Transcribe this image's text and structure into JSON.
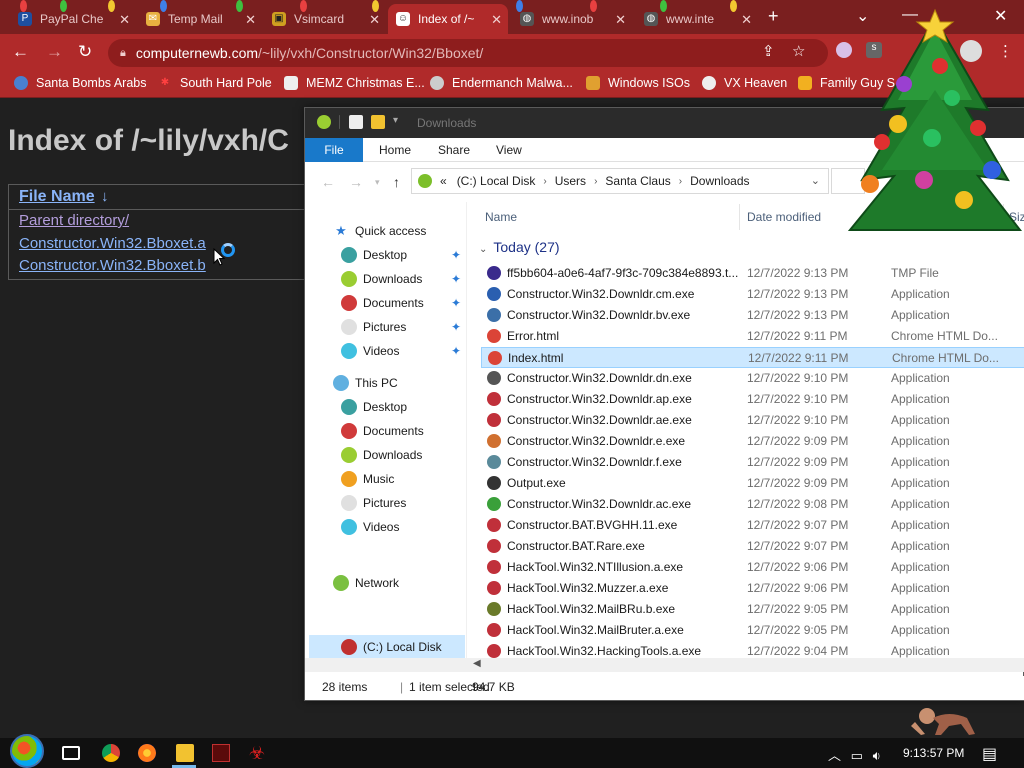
{
  "browser": {
    "tabs": [
      {
        "label": "PayPal Che",
        "active": false
      },
      {
        "label": "Temp Mail",
        "active": false
      },
      {
        "label": "Vsimcard",
        "active": false
      },
      {
        "label": "Index of /~",
        "active": true
      },
      {
        "label": "www.inob",
        "active": false
      },
      {
        "label": "www.inte",
        "active": false
      }
    ],
    "url_host": "computernewb.com",
    "url_path": "/~lily/vxh/Constructor/Win32/Bboxet/",
    "bookmarks": [
      {
        "label": "Santa Bombs Arabs"
      },
      {
        "label": "South Hard Pole"
      },
      {
        "label": "MEMZ Christmas E..."
      },
      {
        "label": "Endermanch Malwa..."
      },
      {
        "label": "Windows ISOs"
      },
      {
        "label": "VX Heaven"
      },
      {
        "label": "Family Guy S"
      }
    ]
  },
  "webpage": {
    "title": "Index of /~lily/vxh/C",
    "column_header": "File Name",
    "sort_arrow": "↓",
    "links": [
      "Parent directory/",
      "Constructor.Win32.Bboxet.a",
      "Constructor.Win32.Bboxet.b"
    ]
  },
  "explorer": {
    "title": "Downloads",
    "ribbon_tabs": [
      "File",
      "Home",
      "Share",
      "View"
    ],
    "breadcrumb": [
      "(C:) Local Disk",
      "Users",
      "Santa Claus",
      "Downloads"
    ],
    "breadcrumb_prefix": "«",
    "nav": {
      "quick_access": "Quick access",
      "quick_items": [
        "Desktop",
        "Downloads",
        "Documents",
        "Pictures",
        "Videos"
      ],
      "this_pc": "This PC",
      "pc_items": [
        "Desktop",
        "Documents",
        "Downloads",
        "Music",
        "Pictures",
        "Videos",
        "(C:) Local Disk"
      ],
      "network": "Network"
    },
    "columns": {
      "name": "Name",
      "date": "Date modified",
      "type": "Type",
      "size": "Siz"
    },
    "group_label": "Today (27)",
    "files": [
      {
        "name": "ff5bb604-a0e6-4af7-9f3c-709c384e8893.t...",
        "date": "12/7/2022 9:13 PM",
        "type": "TMP File",
        "icon": "tmp-icon",
        "color": "#3a2a8c"
      },
      {
        "name": "Constructor.Win32.Downldr.cm.exe",
        "date": "12/7/2022 9:13 PM",
        "type": "Application",
        "icon": "exe-icon",
        "color": "#2a5fb0"
      },
      {
        "name": "Constructor.Win32.Downldr.bv.exe",
        "date": "12/7/2022 9:13 PM",
        "type": "Application",
        "icon": "exe-icon",
        "color": "#3b6fa8"
      },
      {
        "name": "Error.html",
        "date": "12/7/2022 9:11 PM",
        "type": "Chrome HTML Do...",
        "icon": "chrome-icon",
        "color": "#db4437"
      },
      {
        "name": "Index.html",
        "date": "12/7/2022 9:11 PM",
        "type": "Chrome HTML Do...",
        "icon": "chrome-icon",
        "color": "#db4437"
      },
      {
        "name": "Constructor.Win32.Downldr.dn.exe",
        "date": "12/7/2022 9:10 PM",
        "type": "Application",
        "icon": "exe-icon",
        "color": "#555555"
      },
      {
        "name": "Constructor.Win32.Downldr.ap.exe",
        "date": "12/7/2022 9:10 PM",
        "type": "Application",
        "icon": "exe-icon",
        "color": "#c0303a"
      },
      {
        "name": "Constructor.Win32.Downldr.ae.exe",
        "date": "12/7/2022 9:10 PM",
        "type": "Application",
        "icon": "exe-icon",
        "color": "#c0303a"
      },
      {
        "name": "Constructor.Win32.Downldr.e.exe",
        "date": "12/7/2022 9:09 PM",
        "type": "Application",
        "icon": "exe-icon",
        "color": "#d07030"
      },
      {
        "name": "Constructor.Win32.Downldr.f.exe",
        "date": "12/7/2022 9:09 PM",
        "type": "Application",
        "icon": "exe-icon",
        "color": "#5a8a9a"
      },
      {
        "name": "Output.exe",
        "date": "12/7/2022 9:09 PM",
        "type": "Application",
        "icon": "exe-icon",
        "color": "#333333"
      },
      {
        "name": "Constructor.Win32.Downldr.ac.exe",
        "date": "12/7/2022 9:08 PM",
        "type": "Application",
        "icon": "exe-icon",
        "color": "#3aa03a"
      },
      {
        "name": "Constructor.BAT.BVGHH.11.exe",
        "date": "12/7/2022 9:07 PM",
        "type": "Application",
        "icon": "exe-icon",
        "color": "#c0303a"
      },
      {
        "name": "Constructor.BAT.Rare.exe",
        "date": "12/7/2022 9:07 PM",
        "type": "Application",
        "icon": "exe-icon",
        "color": "#c0303a"
      },
      {
        "name": "HackTool.Win32.NTIllusion.a.exe",
        "date": "12/7/2022 9:06 PM",
        "type": "Application",
        "icon": "exe-icon",
        "color": "#c0303a"
      },
      {
        "name": "HackTool.Win32.Muzzer.a.exe",
        "date": "12/7/2022 9:06 PM",
        "type": "Application",
        "icon": "exe-icon",
        "color": "#c0303a"
      },
      {
        "name": "HackTool.Win32.MailBRu.b.exe",
        "date": "12/7/2022 9:05 PM",
        "type": "Application",
        "icon": "exe-icon",
        "color": "#6a7a2a"
      },
      {
        "name": "HackTool.Win32.MailBruter.a.exe",
        "date": "12/7/2022 9:05 PM",
        "type": "Application",
        "icon": "biohazard-icon",
        "color": "#c0303a"
      },
      {
        "name": "HackTool.Win32.HackingTools.a.exe",
        "date": "12/7/2022 9:04 PM",
        "type": "Application",
        "icon": "exe-icon",
        "color": "#c0303a"
      }
    ],
    "status": {
      "items": "28 items",
      "selected": "1 item selected",
      "size": "94.7 KB"
    }
  },
  "taskbar": {
    "clock": "9:13:57 PM"
  }
}
